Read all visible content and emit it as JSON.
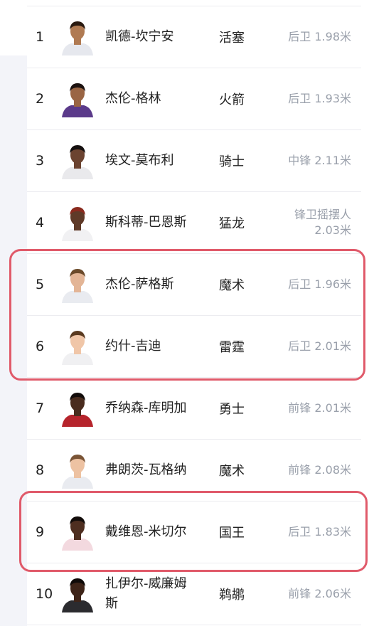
{
  "players": [
    {
      "rank": "1",
      "name": "凯德-坎宁安",
      "team": "活塞",
      "info": "后卫 1.98米",
      "jersey": "#e6e8ee",
      "skin": "#b07a52",
      "hair": "#2a1a10"
    },
    {
      "rank": "2",
      "name": "杰伦-格林",
      "team": "火箭",
      "info": "后卫 1.93米",
      "jersey": "#5b3a8a",
      "skin": "#9a6544",
      "hair": "#1c1210"
    },
    {
      "rank": "3",
      "name": "埃文-莫布利",
      "team": "骑士",
      "info": "中锋 2.11米",
      "jersey": "#e9e9ec",
      "skin": "#6b4330",
      "hair": "#151010"
    },
    {
      "rank": "4",
      "name": "斯科蒂-巴恩斯",
      "team": "猛龙",
      "info": "锋卫摇摆人 2.03米",
      "jersey": "#f1f1f3",
      "skin": "#5f3a28",
      "hair": "#8a2a1e"
    },
    {
      "rank": "5",
      "name": "杰伦-萨格斯",
      "team": "魔术",
      "info": "后卫 1.96米",
      "jersey": "#e9ebf0",
      "skin": "#e3b596",
      "hair": "#6b4a2a"
    },
    {
      "rank": "6",
      "name": "约什-吉迪",
      "team": "雷霆",
      "info": "后卫 2.01米",
      "jersey": "#f0f0f2",
      "skin": "#f0c6a8",
      "hair": "#5a3a20"
    },
    {
      "rank": "7",
      "name": "乔纳森-库明加",
      "team": "勇士",
      "info": "前锋 2.01米",
      "jersey": "#b6242c",
      "skin": "#4a2c1e",
      "hair": "#120c0a"
    },
    {
      "rank": "8",
      "name": "弗朗茨-瓦格纳",
      "team": "魔术",
      "info": "前锋 2.08米",
      "jersey": "#e9ebf0",
      "skin": "#edc2a2",
      "hair": "#7a5436"
    },
    {
      "rank": "9",
      "name": "戴维恩-米切尔",
      "team": "国王",
      "info": "后卫 1.83米",
      "jersey": "#f3d9df",
      "skin": "#4e2e20",
      "hair": "#120c0a"
    },
    {
      "rank": "10",
      "name": "扎伊尔-威廉姆斯",
      "team": "鹈鹕",
      "info": "前锋 2.06米",
      "jersey": "#2b2b2f",
      "skin": "#3e2418",
      "hair": "#0f0a08"
    }
  ],
  "colors": {
    "highlight": "#e05a6a",
    "info_text": "#9aa0ab",
    "divider": "#ececf0",
    "left_strip": "#f3f4f9"
  }
}
